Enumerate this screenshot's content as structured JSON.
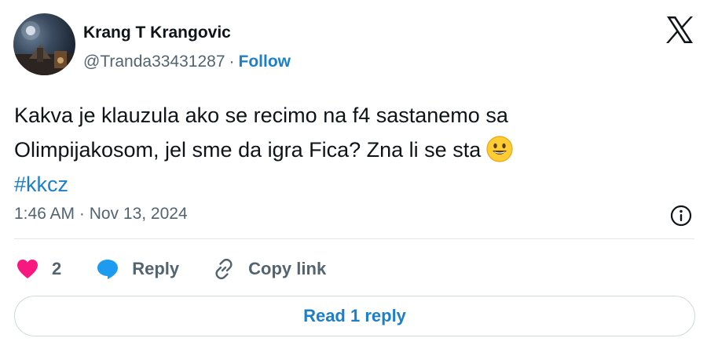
{
  "author": {
    "display_name": "Krang T Krangovic",
    "handle": "@Tranda33431287",
    "separator": "·",
    "follow_label": "Follow"
  },
  "tweet": {
    "line1": "Kakva je klauzula ako se recimo na f4 sastanemo sa",
    "line2": "Olimpijakosom, jel sme da igra Fica? Zna li se sta",
    "emoji": "smiling-face-emoji",
    "hashtag": "#kkcz",
    "timestamp": "1:46 AM · Nov 13, 2024"
  },
  "actions": {
    "like_count": "2",
    "reply_label": "Reply",
    "copy_link_label": "Copy link"
  },
  "read_replies_label": "Read 1 reply",
  "icons": {
    "logo": "x-logo-icon",
    "info": "info-icon",
    "like": "heart-icon",
    "reply": "speech-bubble-icon",
    "copy": "link-icon"
  },
  "colors": {
    "link": "#1d7fc9",
    "like": "#f91880",
    "reply": "#1d9bf0",
    "muted": "#536471",
    "text": "#0f1419"
  }
}
